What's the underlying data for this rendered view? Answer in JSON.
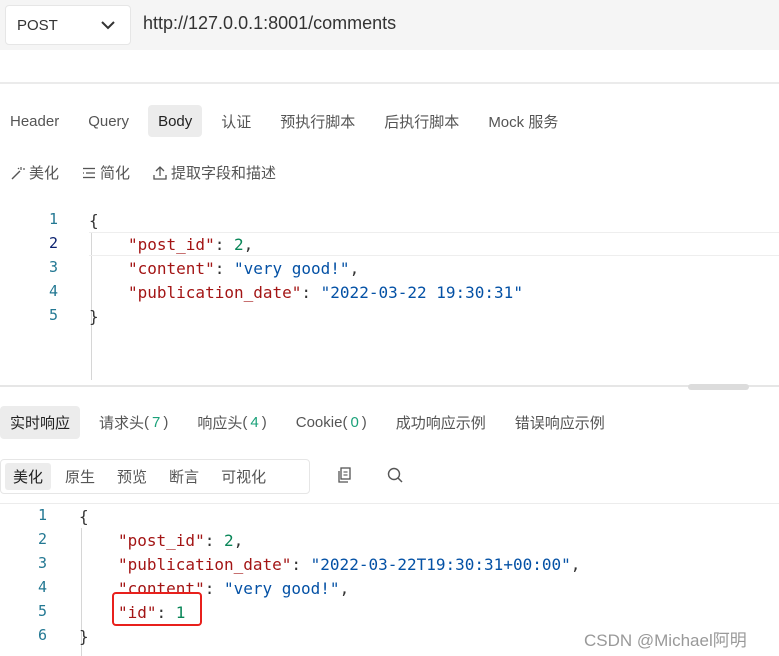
{
  "request": {
    "method": "POST",
    "url": "http://127.0.0.1:8001/comments"
  },
  "tabs": [
    {
      "label": "Header",
      "active": false
    },
    {
      "label": "Query",
      "active": false
    },
    {
      "label": "Body",
      "active": true
    },
    {
      "label": "认证",
      "active": false
    },
    {
      "label": "预执行脚本",
      "active": false
    },
    {
      "label": "后执行脚本",
      "active": false
    },
    {
      "label": "Mock 服务",
      "active": false
    }
  ],
  "body_toolbar": {
    "beautify": "美化",
    "simplify": "简化",
    "extract": "提取字段和描述"
  },
  "request_body": {
    "line_numbers": [
      "1",
      "2",
      "3",
      "4",
      "5"
    ],
    "lines": [
      [
        {
          "t": "p",
          "v": "{"
        }
      ],
      [
        {
          "t": "k",
          "v": "\"post_id\""
        },
        {
          "t": "p",
          "v": ": "
        },
        {
          "t": "n",
          "v": "2"
        },
        {
          "t": "p",
          "v": ","
        }
      ],
      [
        {
          "t": "k",
          "v": "\"content\""
        },
        {
          "t": "p",
          "v": ": "
        },
        {
          "t": "s",
          "v": "\"very good!\""
        },
        {
          "t": "p",
          "v": ","
        }
      ],
      [
        {
          "t": "k",
          "v": "\"publication_date\""
        },
        {
          "t": "p",
          "v": ": "
        },
        {
          "t": "s",
          "v": "\"2022-03-22 19:30:31\""
        }
      ],
      [
        {
          "t": "p",
          "v": "}"
        }
      ]
    ]
  },
  "response_tabs": [
    {
      "label": "实时响应",
      "count": "",
      "active": true
    },
    {
      "label": "请求头",
      "count": "7",
      "active": false
    },
    {
      "label": "响应头",
      "count": "4",
      "active": false
    },
    {
      "label": "Cookie",
      "count": "0",
      "active": false
    },
    {
      "label": "成功响应示例",
      "count": "",
      "active": false
    },
    {
      "label": "错误响应示例",
      "count": "",
      "active": false
    }
  ],
  "response_modes": [
    {
      "label": "美化",
      "active": true
    },
    {
      "label": "原生",
      "active": false
    },
    {
      "label": "预览",
      "active": false
    },
    {
      "label": "断言",
      "active": false
    },
    {
      "label": "可视化",
      "active": false
    }
  ],
  "response_body": {
    "line_numbers": [
      "1",
      "2",
      "3",
      "4",
      "5",
      "6"
    ],
    "lines": [
      [
        {
          "t": "p",
          "v": "{"
        }
      ],
      [
        {
          "t": "k",
          "v": "\"post_id\""
        },
        {
          "t": "p",
          "v": ": "
        },
        {
          "t": "n",
          "v": "2"
        },
        {
          "t": "p",
          "v": ","
        }
      ],
      [
        {
          "t": "k",
          "v": "\"publication_date\""
        },
        {
          "t": "p",
          "v": ": "
        },
        {
          "t": "s",
          "v": "\"2022-03-22T19:30:31+00:00\""
        },
        {
          "t": "p",
          "v": ","
        }
      ],
      [
        {
          "t": "k",
          "v": "\"content\""
        },
        {
          "t": "p",
          "v": ": "
        },
        {
          "t": "s",
          "v": "\"very good!\""
        },
        {
          "t": "p",
          "v": ","
        }
      ],
      [
        {
          "t": "k",
          "v": "\"id\""
        },
        {
          "t": "p",
          "v": ": "
        },
        {
          "t": "n",
          "v": "1"
        }
      ],
      [
        {
          "t": "p",
          "v": "}"
        }
      ]
    ]
  },
  "watermark": "CSDN @Michael阿明",
  "colors": {
    "key": "#a31515",
    "string": "#0451a5",
    "number": "#098658",
    "highlight": "#e8201c",
    "count": "#1aa179"
  },
  "icons": [
    "chevron-down-icon",
    "magic-wand-icon",
    "list-icon",
    "upload-icon",
    "copy-icon",
    "search-icon"
  ]
}
